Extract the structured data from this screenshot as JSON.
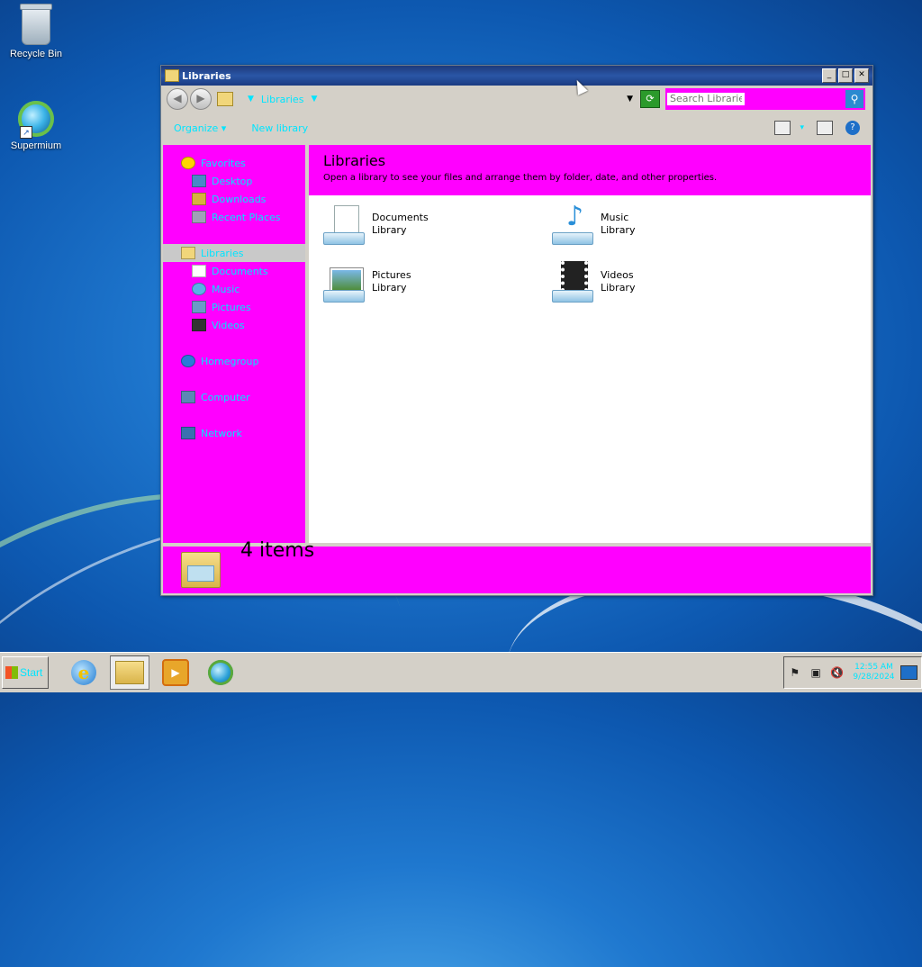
{
  "desktop": {
    "icons": [
      {
        "label": "Recycle Bin"
      },
      {
        "label": "Supermium"
      }
    ]
  },
  "window": {
    "title": "Libraries",
    "controls": {
      "minimize": "_",
      "maximize": "□",
      "close": "✕"
    },
    "address": {
      "crumb": "Libraries"
    },
    "search": {
      "placeholder": "Search Libraries"
    },
    "commands": {
      "organize": "Organize",
      "new_library": "New library"
    },
    "nav": {
      "favorites": "Favorites",
      "favorites_items": [
        "Desktop",
        "Downloads",
        "Recent Places"
      ],
      "libraries": "Libraries",
      "libraries_items": [
        "Documents",
        "Music",
        "Pictures",
        "Videos"
      ],
      "homegroup": "Homegroup",
      "computer": "Computer",
      "network": "Network"
    },
    "content": {
      "title": "Libraries",
      "subtitle": "Open a library to see your files and arrange them by folder, date, and other properties.",
      "libraries": [
        {
          "name": "Documents",
          "type": "Library",
          "icon": "documents-library-icon"
        },
        {
          "name": "Music",
          "type": "Library",
          "icon": "music-library-icon"
        },
        {
          "name": "Pictures",
          "type": "Library",
          "icon": "pictures-library-icon"
        },
        {
          "name": "Videos",
          "type": "Library",
          "icon": "videos-library-icon"
        }
      ]
    },
    "details": {
      "count_text": "4 items"
    }
  },
  "taskbar": {
    "start_label": "Start",
    "clock_time": "12:55 AM",
    "clock_date": "9/28/2024"
  },
  "colors": {
    "highlight": "#ff00ff",
    "accent_text": "#00e5ff"
  }
}
